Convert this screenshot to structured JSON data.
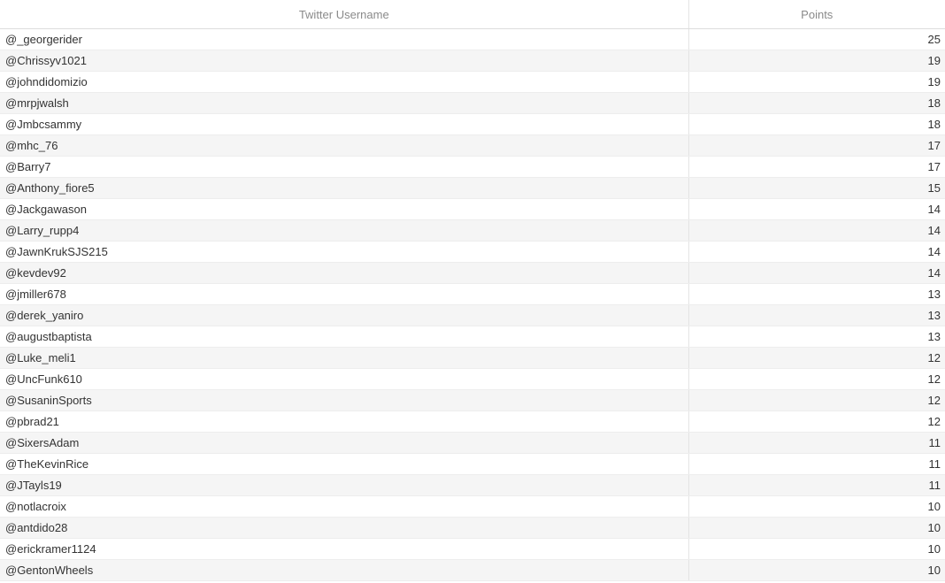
{
  "table": {
    "headers": {
      "username": "Twitter Username",
      "points": "Points"
    },
    "rows": [
      {
        "username": "@_georgerider",
        "points": "25"
      },
      {
        "username": "@Chrissyv1021",
        "points": "19"
      },
      {
        "username": "@johndidomizio",
        "points": "19"
      },
      {
        "username": "@mrpjwalsh",
        "points": "18"
      },
      {
        "username": "@Jmbcsammy",
        "points": "18"
      },
      {
        "username": "@mhc_76",
        "points": "17"
      },
      {
        "username": "@Barry7",
        "points": "17"
      },
      {
        "username": "@Anthony_fiore5",
        "points": "15"
      },
      {
        "username": "@Jackgawason",
        "points": "14"
      },
      {
        "username": "@Larry_rupp4",
        "points": "14"
      },
      {
        "username": "@JawnKrukSJS215",
        "points": "14"
      },
      {
        "username": "@kevdev92",
        "points": "14"
      },
      {
        "username": "@jmiller678",
        "points": "13"
      },
      {
        "username": "@derek_yaniro",
        "points": "13"
      },
      {
        "username": "@augustbaptista",
        "points": "13"
      },
      {
        "username": "@Luke_meli1",
        "points": "12"
      },
      {
        "username": "@UncFunk610",
        "points": "12"
      },
      {
        "username": "@SusaninSports",
        "points": "12"
      },
      {
        "username": "@pbrad21",
        "points": "12"
      },
      {
        "username": "@SixersAdam",
        "points": "11"
      },
      {
        "username": "@TheKevinRice",
        "points": "11"
      },
      {
        "username": "@JTayls19",
        "points": "11"
      },
      {
        "username": "@notlacroix",
        "points": "10"
      },
      {
        "username": "@antdido28",
        "points": "10"
      },
      {
        "username": "@erickramer1124",
        "points": "10"
      },
      {
        "username": "@GentonWheels",
        "points": "10"
      }
    ]
  }
}
